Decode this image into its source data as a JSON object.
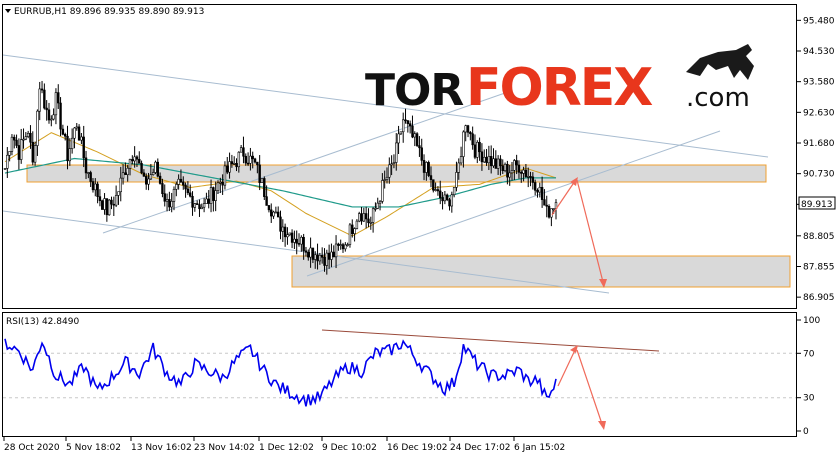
{
  "chart_data": {
    "type": "candlestick",
    "symbol_header": "EURRUB,H1  89.896 89.935 89.890 89.913",
    "current_price_label": "89.913",
    "price_ticks": [
      "95.480",
      "94.530",
      "93.580",
      "92.630",
      "91.680",
      "90.730",
      "89.780",
      "88.805",
      "87.855",
      "86.905"
    ],
    "price_tick_values": [
      95.48,
      94.53,
      93.58,
      92.63,
      91.68,
      90.73,
      89.78,
      88.805,
      87.855,
      86.905
    ],
    "ylim": [
      86.6,
      95.8
    ],
    "rsi_header": "RSI(13) 42.8490",
    "rsi_ticks": [
      "100",
      "70",
      "30",
      "0"
    ],
    "rsi_tick_values": [
      100,
      70,
      30,
      0
    ],
    "x_ticks": [
      "28 Oct 2020",
      "5 Nov 18:02",
      "13 Nov 16:02",
      "23 Nov 14:02",
      "1 Dec 12:02",
      "9 Dec 10:02",
      "16 Dec 19:02",
      "24 Dec 17:02",
      "6 Jan 15:02"
    ],
    "price_keyframes": [
      [
        0,
        90.9
      ],
      [
        3,
        92.0
      ],
      [
        6,
        91.4
      ],
      [
        10,
        92.1
      ],
      [
        12,
        91.0
      ],
      [
        15,
        93.5
      ],
      [
        19,
        92.4
      ],
      [
        22,
        93.0
      ],
      [
        27,
        91.3
      ],
      [
        31,
        92.3
      ],
      [
        35,
        90.9
      ],
      [
        40,
        90.1
      ],
      [
        44,
        89.6
      ],
      [
        48,
        90.0
      ],
      [
        52,
        90.9
      ],
      [
        56,
        91.5
      ],
      [
        60,
        90.4
      ],
      [
        65,
        90.9
      ],
      [
        70,
        89.8
      ],
      [
        75,
        90.3
      ],
      [
        80,
        90.0
      ],
      [
        86,
        89.7
      ],
      [
        92,
        90.4
      ],
      [
        97,
        90.9
      ],
      [
        103,
        91.4
      ],
      [
        108,
        91.0
      ],
      [
        113,
        90.0
      ],
      [
        118,
        89.2
      ],
      [
        123,
        88.9
      ],
      [
        128,
        88.6
      ],
      [
        133,
        88.3
      ],
      [
        140,
        88.1
      ],
      [
        147,
        88.6
      ],
      [
        153,
        89.6
      ],
      [
        158,
        89.2
      ],
      [
        163,
        90.3
      ],
      [
        168,
        91.1
      ],
      [
        172,
        92.4
      ],
      [
        177,
        91.7
      ],
      [
        181,
        91.0
      ],
      [
        186,
        90.1
      ],
      [
        191,
        89.8
      ],
      [
        195,
        90.5
      ],
      [
        199,
        92.4
      ],
      [
        203,
        91.5
      ],
      [
        207,
        91.3
      ],
      [
        212,
        91.0
      ],
      [
        217,
        90.8
      ],
      [
        222,
        91.0
      ],
      [
        226,
        90.7
      ],
      [
        230,
        90.4
      ],
      [
        234,
        89.5
      ],
      [
        238,
        89.9
      ]
    ],
    "price_n": 239,
    "ma_fast_keyframes": [
      [
        0,
        91.1
      ],
      [
        20,
        92.0
      ],
      [
        40,
        91.4
      ],
      [
        60,
        90.7
      ],
      [
        80,
        90.3
      ],
      [
        100,
        90.5
      ],
      [
        115,
        90.2
      ],
      [
        130,
        89.5
      ],
      [
        150,
        88.8
      ],
      [
        165,
        89.4
      ],
      [
        185,
        90.3
      ],
      [
        205,
        90.4
      ],
      [
        225,
        90.9
      ],
      [
        238,
        90.6
      ]
    ],
    "ma_slow_keyframes": [
      [
        0,
        90.75
      ],
      [
        30,
        91.2
      ],
      [
        60,
        91.0
      ],
      [
        90,
        90.6
      ],
      [
        120,
        90.2
      ],
      [
        150,
        89.7
      ],
      [
        170,
        89.7
      ],
      [
        190,
        90.0
      ],
      [
        210,
        90.4
      ],
      [
        225,
        90.6
      ],
      [
        238,
        90.6
      ]
    ],
    "rsi_keyframes": [
      [
        0,
        80
      ],
      [
        6,
        72
      ],
      [
        12,
        55
      ],
      [
        16,
        82
      ],
      [
        22,
        50
      ],
      [
        28,
        42
      ],
      [
        34,
        58
      ],
      [
        40,
        36
      ],
      [
        46,
        48
      ],
      [
        52,
        62
      ],
      [
        58,
        52
      ],
      [
        64,
        74
      ],
      [
        70,
        52
      ],
      [
        76,
        42
      ],
      [
        82,
        60
      ],
      [
        88,
        54
      ],
      [
        94,
        48
      ],
      [
        100,
        64
      ],
      [
        106,
        74
      ],
      [
        112,
        54
      ],
      [
        118,
        40
      ],
      [
        124,
        34
      ],
      [
        130,
        28
      ],
      [
        136,
        30
      ],
      [
        142,
        46
      ],
      [
        148,
        58
      ],
      [
        154,
        54
      ],
      [
        160,
        70
      ],
      [
        166,
        72
      ],
      [
        172,
        80
      ],
      [
        178,
        64
      ],
      [
        184,
        50
      ],
      [
        190,
        38
      ],
      [
        194,
        44
      ],
      [
        198,
        76
      ],
      [
        204,
        60
      ],
      [
        210,
        50
      ],
      [
        216,
        50
      ],
      [
        222,
        55
      ],
      [
        226,
        45
      ],
      [
        230,
        46
      ],
      [
        234,
        28
      ],
      [
        238,
        43
      ]
    ],
    "rsi_n": 239
  }
}
